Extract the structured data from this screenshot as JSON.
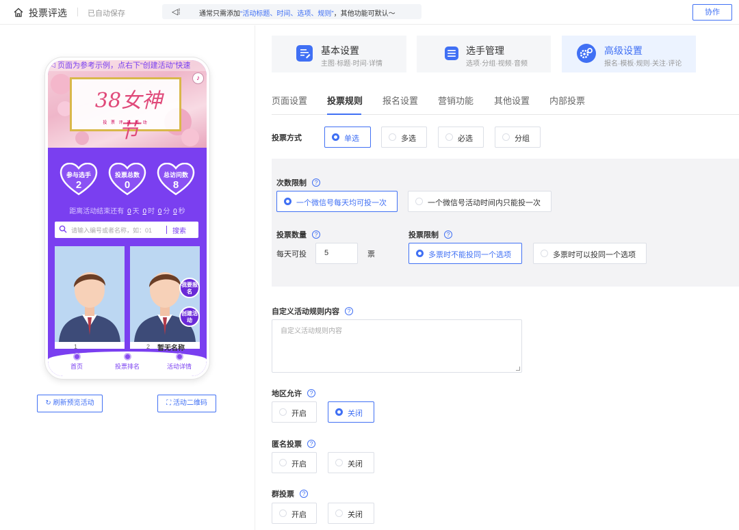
{
  "topbar": {
    "title": "投票评选",
    "saved": "已自动保存",
    "notice_prefix": "通常只需添加",
    "notice_highlight": "“活动标题、时间、选项、规则”",
    "notice_suffix": "，其他功能可默认～",
    "collab_label": "协作"
  },
  "preview": {
    "marquee": "页面为参考示例，点右下“创建活动”快速",
    "banner_title": "38女神节",
    "banner_sub": "投 票 评 选 活 动",
    "stats": [
      {
        "label": "参与选手",
        "value": "2"
      },
      {
        "label": "投票总数",
        "value": "0"
      },
      {
        "label": "总访问数",
        "value": "8"
      }
    ],
    "countdown_prefix": "距离活动结束还有",
    "countdown": [
      {
        "n": "0",
        "u": "天"
      },
      {
        "n": "0",
        "u": "时"
      },
      {
        "n": "0",
        "u": "分"
      },
      {
        "n": "0",
        "u": "秒"
      }
    ],
    "search_placeholder": "请输入编号或者名称，如：01",
    "search_button": "搜索",
    "cards": [
      {
        "no": "1",
        "name": ""
      },
      {
        "no": "2",
        "name": "暂无名称"
      }
    ],
    "float_signup": "我要报名",
    "float_create": "创建活动",
    "nav": [
      "首页",
      "投票排名",
      "活动详情"
    ],
    "refresh_button": "刷新预览活动",
    "qrcode_button": "活动二维码"
  },
  "categories": [
    {
      "title": "基本设置",
      "sub": "主图·标题·时间·详情",
      "icon": "edit-icon"
    },
    {
      "title": "选手管理",
      "sub": "选项·分组·视频·音频",
      "icon": "list-icon"
    },
    {
      "title": "高级设置",
      "sub": "报名·模板·规则·关注·评论",
      "icon": "gear-icon"
    }
  ],
  "tabs": [
    "页面设置",
    "投票规则",
    "报名设置",
    "营销功能",
    "其他设置",
    "内部投票"
  ],
  "vote_mode": {
    "label": "投票方式",
    "options": [
      "单选",
      "多选",
      "必选",
      "分组"
    ],
    "selected": "单选"
  },
  "count_limit": {
    "label": "次数限制",
    "options": [
      "一个微信号每天均可投一次",
      "一个微信号活动时间内只能投一次"
    ]
  },
  "vote_count": {
    "label": "投票数量",
    "prefix": "每天可投",
    "value": "5",
    "unit": "票"
  },
  "vote_limit": {
    "label": "投票限制",
    "options": [
      "多票时不能投同一个选项",
      "多票时可以投同一个选项"
    ]
  },
  "custom_rules": {
    "label": "自定义活动规则内容",
    "placeholder": "自定义活动规则内容"
  },
  "region": {
    "label": "地区允许",
    "on": "开启",
    "off": "关闭"
  },
  "anonymous": {
    "label": "匿名投票",
    "on": "开启",
    "off": "关闭"
  },
  "group_vote": {
    "label": "群投票",
    "on": "开启",
    "off": "关闭"
  },
  "colors": {
    "accent": "#4070f4",
    "preview_purple": "#7a3ff0"
  }
}
